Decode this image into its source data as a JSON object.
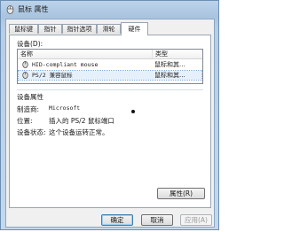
{
  "window": {
    "title": "鼠标 属性"
  },
  "tabs": [
    {
      "label": "鼠标键",
      "active": false
    },
    {
      "label": "指针",
      "active": false
    },
    {
      "label": "指针选项",
      "active": false
    },
    {
      "label": "滑轮",
      "active": false
    },
    {
      "label": "硬件",
      "active": true
    }
  ],
  "devices": {
    "label": "设备(D):",
    "columns": [
      "名称",
      "类型"
    ],
    "rows": [
      {
        "name": "HID-compliant mouse",
        "type": "鼠标和其...",
        "selected": false
      },
      {
        "name": "PS/2 兼容鼠标",
        "type": "鼠标和其...",
        "selected": true
      }
    ]
  },
  "properties": {
    "title": "设备属性",
    "items": [
      {
        "key": "制造商:",
        "value": "Microsoft"
      },
      {
        "key": "位置:",
        "value": "插入的 PS/2 鼠标端口"
      },
      {
        "key": "设备状态:",
        "value": "这个设备运转正常。"
      }
    ],
    "button_label": "属性(R)"
  },
  "footer": {
    "ok_label": "确定",
    "cancel_label": "取消",
    "apply_label": "应用(A)"
  },
  "icons": {
    "title": "mouse-icon",
    "row": "mouse-icon"
  },
  "colors": {
    "frame": "#b6cde6",
    "selection": "#e6f0fb",
    "focus": "#3c7fb1"
  }
}
